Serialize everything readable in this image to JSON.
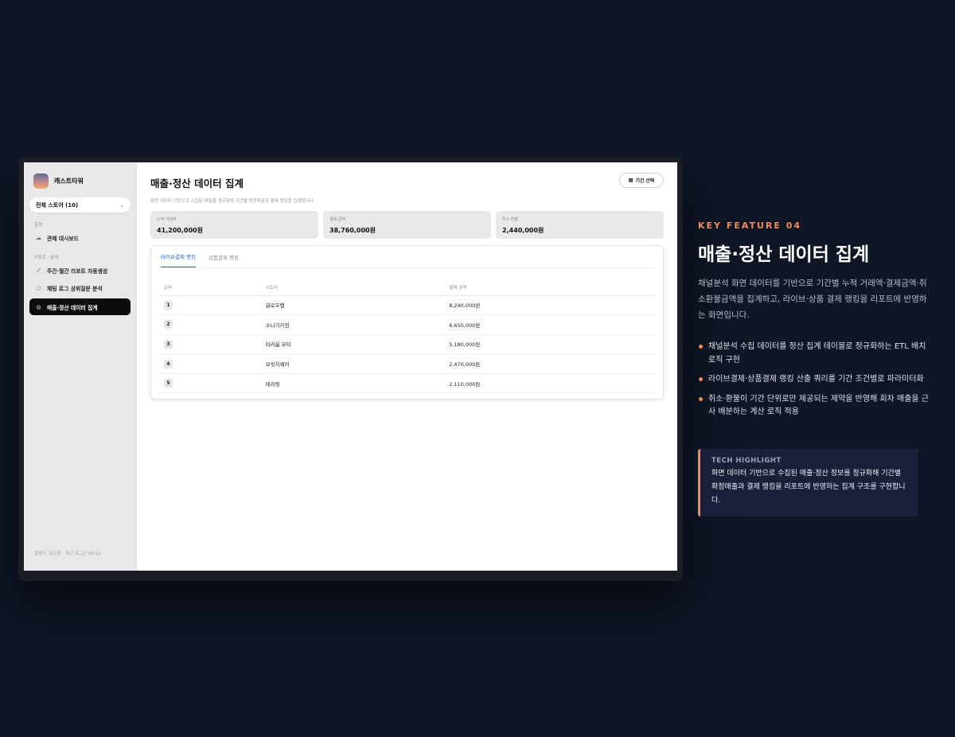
{
  "app": {
    "brand_name": "캐스트타워",
    "store_select": "전체 스토어 (10)",
    "section_ops": "운영",
    "section_reports": "리포트 · 분석",
    "nav": [
      {
        "label": "관제 대시보드",
        "icon": "cloud-icon"
      },
      {
        "label": "주간·월간 리포트 자동생성",
        "icon": "chart-line-icon"
      },
      {
        "label": "채팅 로그 상위질문 분석",
        "icon": "chat-icon"
      },
      {
        "label": "매출·정산 데이터 집계",
        "icon": "coins-icon",
        "active": true
      }
    ],
    "footer": "운영자: 김도윤 · 최근 로그인 09:12"
  },
  "main": {
    "title": "매출·정산 데이터 집계",
    "subtitle": "화면 데이터 기반으로 수집된 매출을 정규화해 기간별 확정매출과 결제 랭킹을 집계합니다",
    "period_button": "기간 선택",
    "cards": [
      {
        "label": "누적 거래액",
        "value": "41,200,000원"
      },
      {
        "label": "결제 금액",
        "value": "38,760,000원"
      },
      {
        "label": "취소 환불",
        "value": "2,440,000원"
      }
    ],
    "tabs": [
      "라이브결제 랭킹",
      "상품결제 랭킹"
    ],
    "table": {
      "headers": [
        "순위",
        "스토어",
        "결제 금액"
      ],
      "rows": [
        {
          "rank": "1",
          "store": "글로우랩",
          "amount": "8,240,000원"
        },
        {
          "rank": "2",
          "store": "소나기키친",
          "amount": "6,650,000원"
        },
        {
          "rank": "3",
          "store": "미러룸 뷰티",
          "amount": "5,180,000원"
        },
        {
          "rank": "4",
          "store": "브릿지웨어",
          "amount": "2,470,000원"
        },
        {
          "rank": "5",
          "store": "테라핏",
          "amount": "2,110,000원"
        }
      ]
    }
  },
  "feature": {
    "kicker": "KEY FEATURE 04",
    "title": "매출·정산 데이터 집계",
    "description": "채널분석 화면 데이터를 기반으로 기간별 누적 거래액·결제금액·취소환불금액을 집계하고, 라이브·상품 결제 랭킹을 리포트에 반영하는 화면입니다.",
    "bullets": [
      "채널분석 수집 데이터를 정산 집계 테이블로 정규화하는 ETL 배치 로직 구현",
      "라이브결제·상품결제 랭킹 산출 쿼리를 기간 조건별로 파라미터화",
      "취소·환불이 기간 단위로만 제공되는 제약을 반영해 회차 매출을 근사 배분하는 계산 로직 적용"
    ],
    "highlight_title": "TECH HIGHLIGHT",
    "highlight_body": "화면 데이터 기반으로 수집된 매출·정산 정보를 정규화해 기간별 확정매출과 결제 랭킹을 리포트에 반영하는 집계 구조를 구현합니다."
  },
  "colors": {
    "accent": "#f08a5d",
    "background": "#0f1626",
    "tab_active": "#2d5fbf"
  }
}
